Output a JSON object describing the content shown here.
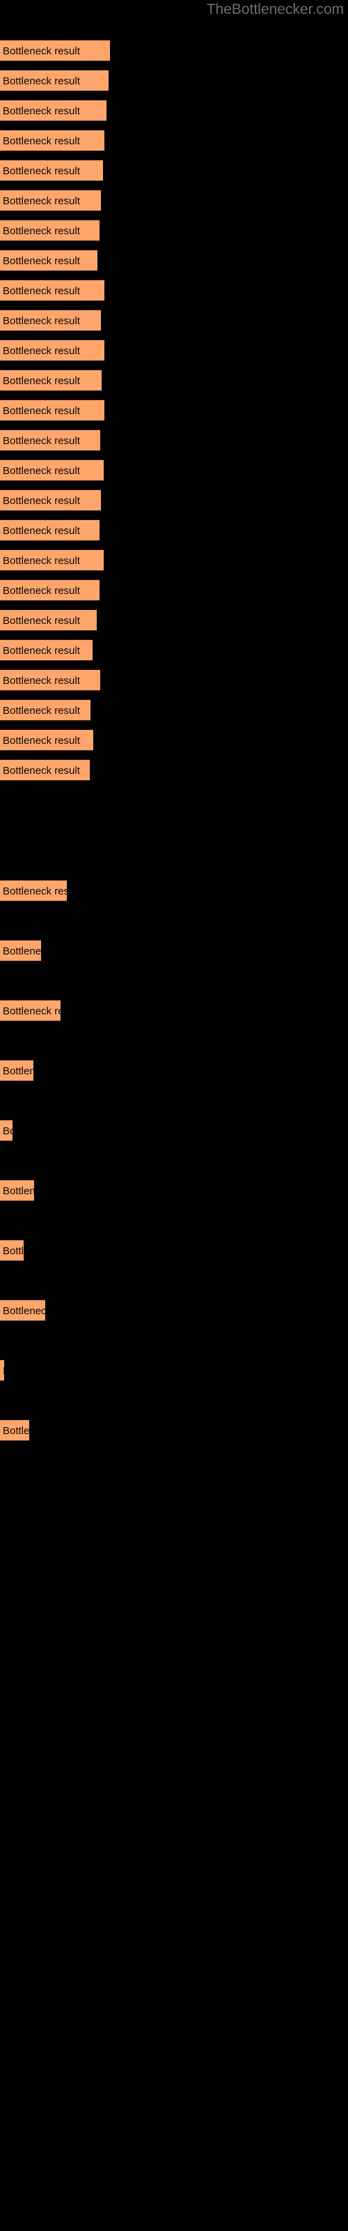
{
  "site": {
    "title": "TheBottlenecker.com",
    "title_color": "#6e6e6e"
  },
  "colors": {
    "background": "#000000",
    "bar_fill": "#ffa66d",
    "bar_edge": "#2a1a10",
    "bar_label": "#0a0a0a",
    "watermark": "#6e6e6e"
  },
  "chart_data": {
    "type": "bar",
    "orientation": "horizontal",
    "title": "",
    "subtitle": "",
    "xlabel": "",
    "ylabel": "",
    "grid": false,
    "legend": null,
    "axis_visible": false,
    "tick_labels_visible": false,
    "bar_label_text": "Bottleneck result",
    "xlim": [
      0,
      500
    ],
    "categories": [
      "Bottleneck result",
      "Bottleneck result",
      "Bottleneck result",
      "Bottleneck result",
      "Bottleneck result",
      "Bottleneck result",
      "Bottleneck result",
      "Bottleneck result",
      "Bottleneck result",
      "Bottleneck result",
      "Bottleneck result",
      "Bottleneck result",
      "Bottleneck result",
      "Bottleneck result",
      "Bottleneck result",
      "Bottleneck result",
      "Bottleneck result",
      "Bottleneck result",
      "Bottleneck result",
      "Bottleneck result",
      "Bottleneck result",
      "Bottleneck result",
      "Bottleneck result"
    ],
    "values": [
      158,
      156,
      153,
      150,
      148,
      145,
      143,
      140,
      138,
      136,
      133,
      130,
      127,
      124,
      96,
      59,
      87,
      48,
      18,
      49,
      34,
      65,
      6,
      42
    ],
    "bars": [
      {
        "index": 1,
        "label": "Bottleneck result",
        "width": 158,
        "y": 57
      },
      {
        "index": 2,
        "label": "Bottleneck result",
        "width": 156,
        "y": 100
      },
      {
        "index": 3,
        "label": "Bottleneck result",
        "width": 153,
        "y": 143
      },
      {
        "index": 4,
        "label": "Bottleneck result",
        "width": 150,
        "y": 186
      },
      {
        "index": 5,
        "label": "Bottleneck result",
        "width": 148,
        "y": 229
      },
      {
        "index": 6,
        "label": "Bottleneck result",
        "width": 145,
        "y": 272
      },
      {
        "index": 7,
        "label": "Bottleneck result",
        "width": 143,
        "y": 315
      },
      {
        "index": 8,
        "label": "Bottleneck result",
        "width": 140,
        "y": 358
      },
      {
        "index": 9,
        "label": "Bottleneck result",
        "width": 150,
        "y": 401
      },
      {
        "index": 10,
        "label": "Bottleneck result",
        "width": 145,
        "y": 444
      },
      {
        "index": 11,
        "label": "Bottleneck result",
        "width": 150,
        "y": 487
      },
      {
        "index": 12,
        "label": "Bottleneck result",
        "width": 146,
        "y": 530
      },
      {
        "index": 13,
        "label": "Bottleneck result",
        "width": 150,
        "y": 573
      },
      {
        "index": 14,
        "label": "Bottleneck result",
        "width": 144,
        "y": 616
      },
      {
        "index": 15,
        "label": "Bottleneck result",
        "width": 149,
        "y": 659
      },
      {
        "index": 16,
        "label": "Bottleneck result",
        "width": 145,
        "y": 702
      },
      {
        "index": 17,
        "label": "Bottleneck result",
        "width": 143,
        "y": 745
      },
      {
        "index": 18,
        "label": "Bottleneck result",
        "width": 149,
        "y": 788
      },
      {
        "index": 19,
        "label": "Bottleneck result",
        "width": 143,
        "y": 831
      },
      {
        "index": 20,
        "label": "Bottleneck result",
        "width": 139,
        "y": 874
      },
      {
        "index": 21,
        "label": "Bottleneck result",
        "width": 133,
        "y": 917
      },
      {
        "index": 22,
        "label": "Bottleneck result",
        "width": 144,
        "y": 960
      },
      {
        "index": 23,
        "label": "Bottleneck result",
        "width": 130,
        "y": 1003
      },
      {
        "index": 24,
        "label": "Bottleneck result",
        "width": 134,
        "y": 1046
      },
      {
        "index": 25,
        "label": "Bottleneck result",
        "width": 129,
        "y": 1089
      },
      {
        "index": 26,
        "label": "Bottleneck result",
        "width": 96,
        "y": 1262
      },
      {
        "index": 27,
        "label": "Bottleneck result",
        "width": 59,
        "y": 1348
      },
      {
        "index": 28,
        "label": "Bottleneck result",
        "width": 87,
        "y": 1434
      },
      {
        "index": 29,
        "label": "Bottleneck result",
        "width": 48,
        "y": 1520
      },
      {
        "index": 30,
        "label": "Bottleneck result",
        "width": 18,
        "y": 1606
      },
      {
        "index": 31,
        "label": "Bottleneck result",
        "width": 49,
        "y": 1692
      },
      {
        "index": 32,
        "label": "Bottleneck result",
        "width": 34,
        "y": 1778
      },
      {
        "index": 33,
        "label": "Bottleneck result",
        "width": 65,
        "y": 1864
      },
      {
        "index": 34,
        "label": "Bottleneck result",
        "width": 6,
        "y": 1950
      },
      {
        "index": 35,
        "label": "Bottleneck result",
        "width": 42,
        "y": 2036
      }
    ]
  }
}
